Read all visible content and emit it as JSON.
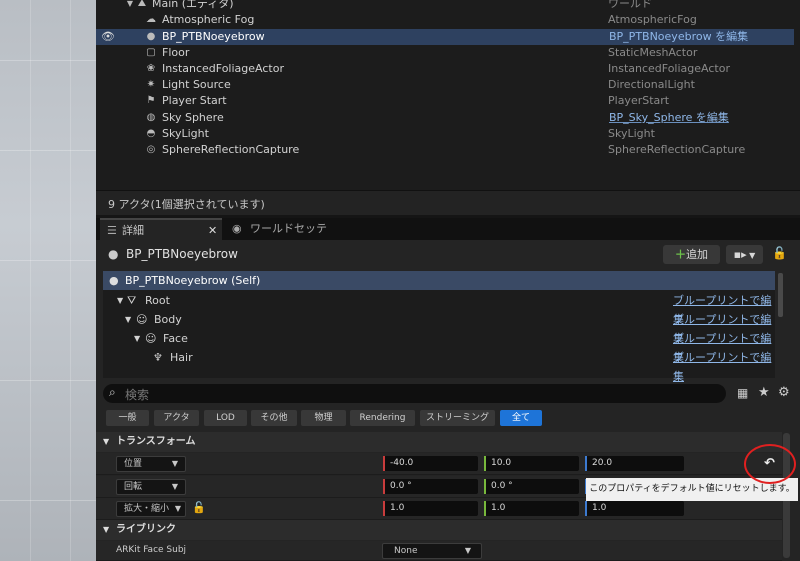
{
  "outliner": {
    "root": {
      "label": "Main (エディタ)",
      "type": "ワールド"
    },
    "rows": [
      {
        "label": "Atmospheric Fog",
        "type": "AtmosphericFog",
        "icon": "fog-icon"
      },
      {
        "label": "BP_PTBNoeyebrow",
        "type": "BP_PTBNoeyebrow を編集",
        "icon": "blueprint-actor-icon"
      },
      {
        "label": "Floor",
        "type": "StaticMeshActor",
        "icon": "static-mesh-icon"
      },
      {
        "label": "InstancedFoliageActor",
        "type": "InstancedFoliageActor",
        "icon": "foliage-icon"
      },
      {
        "label": "Light Source",
        "type": "DirectionalLight",
        "icon": "directional-light-icon"
      },
      {
        "label": "Player Start",
        "type": "PlayerStart",
        "icon": "player-start-icon"
      },
      {
        "label": "Sky Sphere",
        "type": "BP_Sky_Sphere を編集",
        "icon": "sky-sphere-icon"
      },
      {
        "label": "SkyLight",
        "type": "SkyLight",
        "icon": "skylight-icon"
      },
      {
        "label": "SphereReflectionCapture",
        "type": "SphereReflectionCapture",
        "icon": "reflection-capture-icon"
      }
    ],
    "status": "9 アクタ(1個選択されています)"
  },
  "tabs": {
    "details": "詳細",
    "world_settings": "ワールドセッティ..."
  },
  "details": {
    "actor_name": "BP_PTBNoeyebrow",
    "add_label": "追加",
    "components": [
      {
        "label": "BP_PTBNoeyebrow (Self)",
        "link": ""
      },
      {
        "label": "Root",
        "link": "ブループリントで編集"
      },
      {
        "label": "Body",
        "link": "ブループリントで編集"
      },
      {
        "label": "Face",
        "link": "ブループリントで編集"
      },
      {
        "label": "Hair",
        "link": "ブループリントで編集"
      }
    ],
    "search_placeholder": "検索",
    "filters": [
      "一般",
      "アクタ",
      "LOD",
      "その他",
      "物理",
      "Rendering",
      "ストリーミング",
      "全て"
    ],
    "transform_section": "トランスフォーム",
    "location": {
      "label": "位置",
      "x": "-40.0",
      "y": "10.0",
      "z": "20.0"
    },
    "rotation": {
      "label": "回転",
      "x": "0.0 °",
      "y": "0.0 °",
      "z": ""
    },
    "scale": {
      "label": "拡大・縮小",
      "x": "1.0",
      "y": "1.0",
      "z": "1.0"
    },
    "livelink_section": "ライブリンク",
    "arkit": {
      "label": "ARKit Face Subj",
      "value": "None"
    },
    "tooltip": "このプロパティをデフォルト値にリセットします。"
  },
  "colors": {
    "selection": "#2e4160",
    "accent": "#1e74d8",
    "annotation": "#e02020"
  }
}
